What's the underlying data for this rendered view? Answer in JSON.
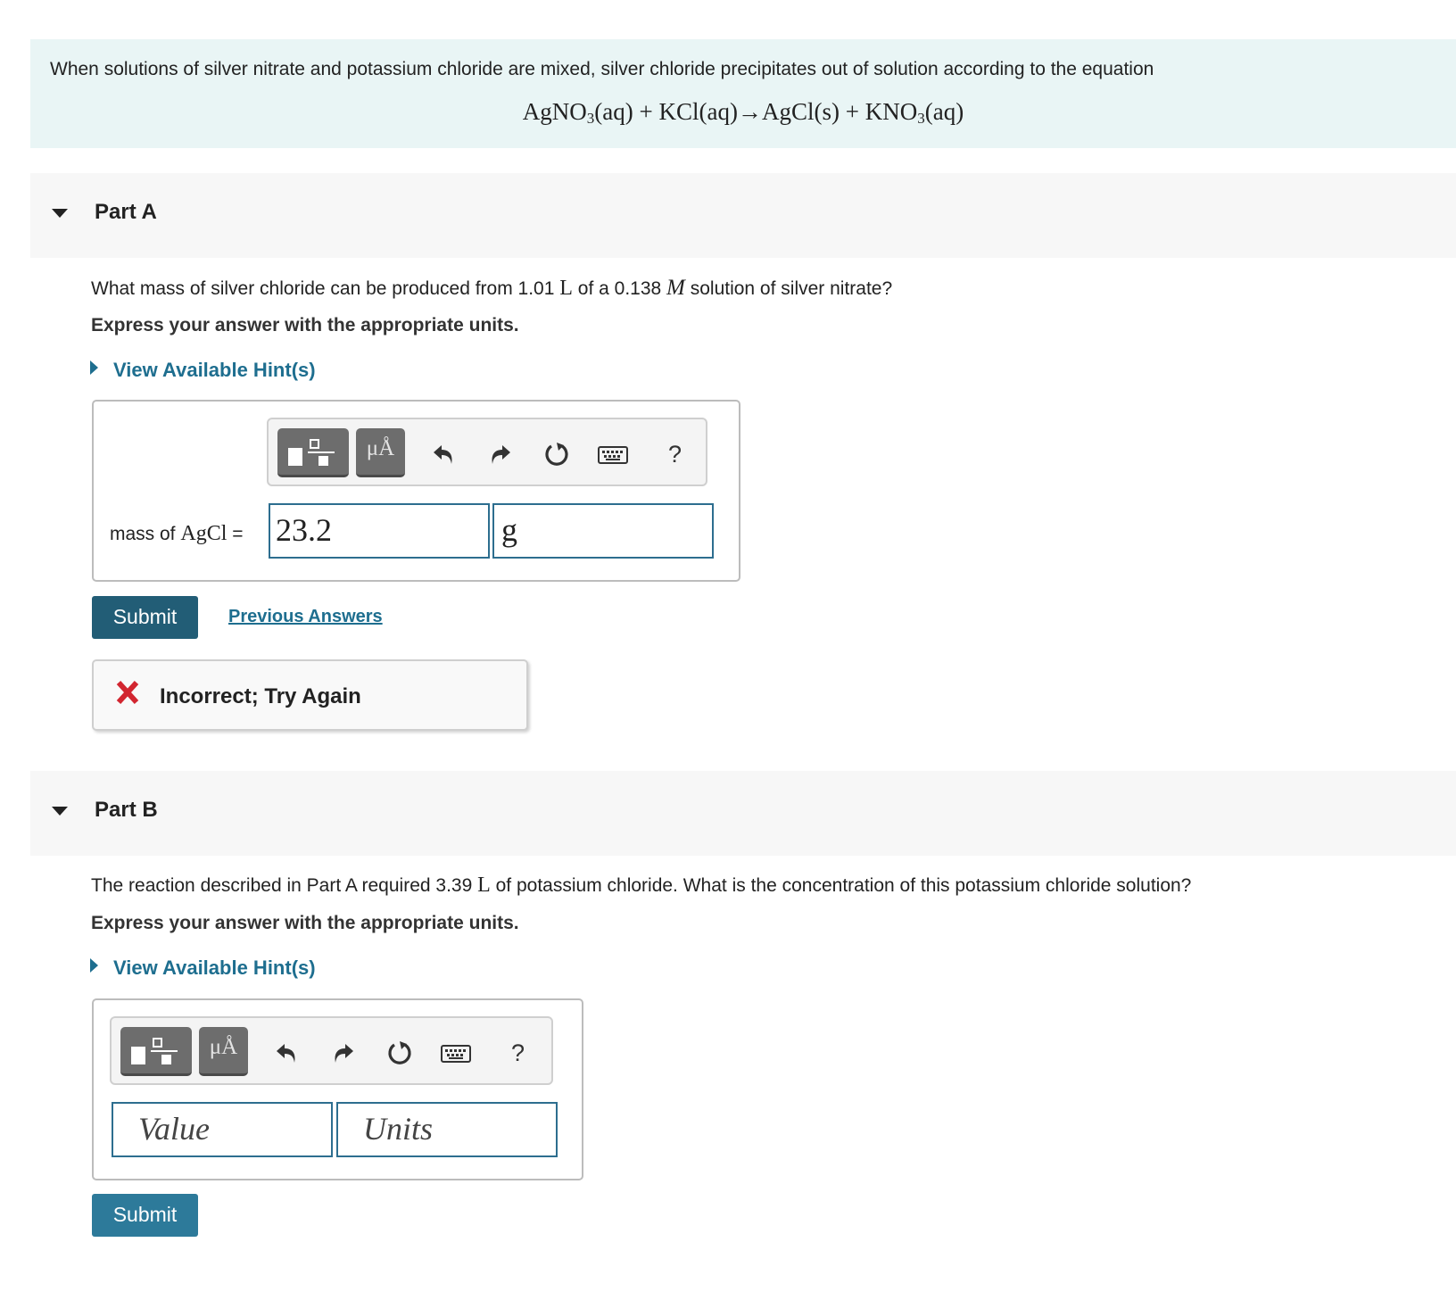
{
  "intro": {
    "text": "When solutions of silver nitrate and potassium chloride are mixed, silver chloride precipitates out of solution according to the equation",
    "equation": {
      "reactant1": "AgNO",
      "reactant1_sub": "3",
      "reactant1_state": "(aq)",
      "plus1": "+",
      "reactant2": "KCl(aq)",
      "arrow": "→",
      "product1": "AgCl(s)",
      "plus2": "+",
      "product2": "KNO",
      "product2_sub": "3",
      "product2_state": "(aq)"
    }
  },
  "part_a": {
    "title": "Part A",
    "question_pre": "What mass of silver chloride can be produced from 1.01",
    "unit_L": "L",
    "question_mid": "of a 0.138",
    "unit_M": "M",
    "question_post": "solution of silver nitrate?",
    "instruction": "Express your answer with the appropriate units.",
    "hint_label": "View Available Hint(s)",
    "toolbar": {
      "units_button": "μÅ",
      "help": "?"
    },
    "answer_label_pre": "mass of",
    "answer_label_formula": "AgCl",
    "answer_label_eq": "=",
    "value": "23.2",
    "units": "g",
    "submit_label": "Submit",
    "previous_answers_label": "Previous Answers",
    "feedback": "Incorrect; Try Again"
  },
  "part_b": {
    "title": "Part B",
    "question_pre": "The reaction described in Part A required 3.39",
    "unit_L": "L",
    "question_post": "of potassium chloride. What is the concentration of this potassium chloride solution?",
    "instruction": "Express your answer with the appropriate units.",
    "hint_label": "View Available Hint(s)",
    "toolbar": {
      "units_button": "μÅ",
      "help": "?"
    },
    "value_placeholder": "Value",
    "units_placeholder": "Units",
    "submit_label": "Submit"
  },
  "colors": {
    "intro_bg": "#e9f5f5",
    "part_header_bg": "#f7f7f7",
    "link": "#1e6e8f",
    "submit_dark": "#225d76",
    "submit": "#2d7a9a",
    "error": "#d22630"
  },
  "icons": [
    "templates-icon",
    "units-icon",
    "undo-icon",
    "redo-icon",
    "reset-icon",
    "keyboard-icon",
    "help-icon",
    "collapse-triangle-icon",
    "hint-triangle-icon",
    "incorrect-x-icon"
  ]
}
